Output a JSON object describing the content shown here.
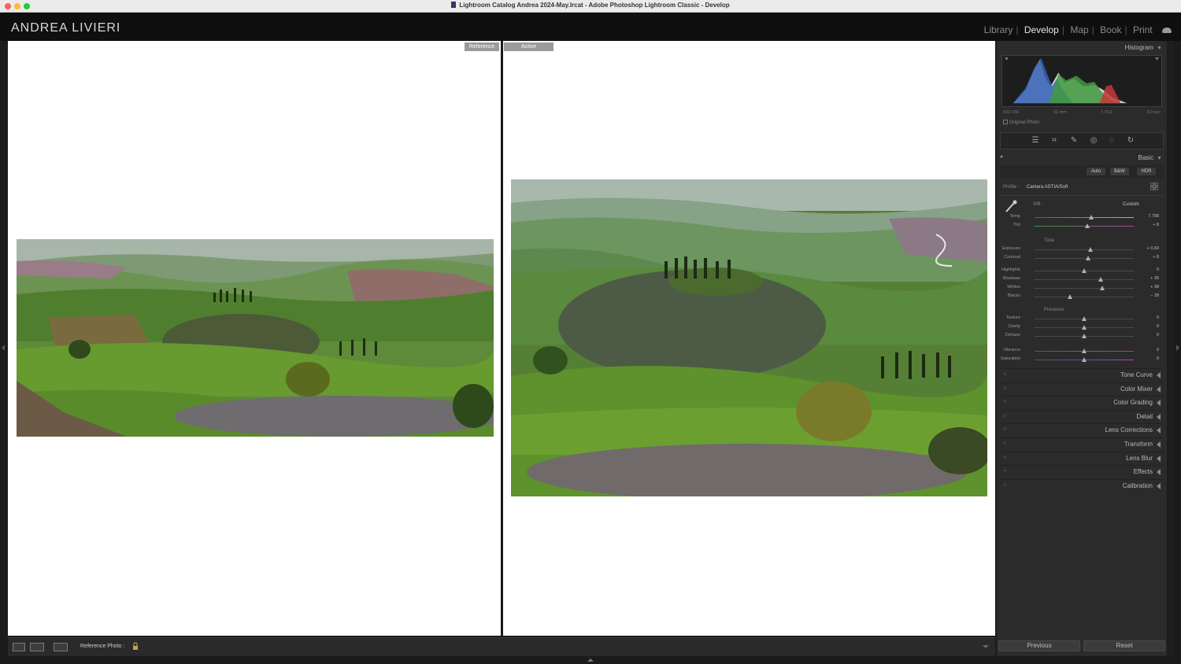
{
  "window": {
    "title": "Lightroom Catalog Andrea 2024-May.lrcat - Adobe Photoshop Lightroom Classic - Develop"
  },
  "header": {
    "identity": "ANDREA LIVIERI",
    "modules": [
      "Library",
      "Develop",
      "Map",
      "Book",
      "Print"
    ],
    "active_module": "Develop"
  },
  "view": {
    "reference_tag": "Reference",
    "active_tag": "Active"
  },
  "toolbar": {
    "reference_photo_label": "Reference Photo :"
  },
  "panel": {
    "histogram_title": "Histogram",
    "histogram_info": {
      "iso": "ISO 160",
      "focal": "61 mm",
      "aperture": "f / 8,0",
      "shutter": "3,0 sec"
    },
    "original_photo_label": "Original Photo",
    "basic_title": "Basic",
    "treatment_buttons": [
      "Auto",
      "B&W",
      "HDR"
    ],
    "profile_label": "Profile :",
    "profile_value": "Camera ASTIA/Soft",
    "wb_label": "WB :",
    "wb_value": "Custom",
    "tone_label": "Tone",
    "presence_label": "Presence",
    "sliders": {
      "temp": {
        "name": "Temp",
        "value": "7.798",
        "pos": 0.57
      },
      "tint": {
        "name": "Tint",
        "value": "+ 8",
        "pos": 0.53
      },
      "exposure": {
        "name": "Exposure",
        "value": "+ 0,60",
        "pos": 0.56
      },
      "contrast": {
        "name": "Contrast",
        "value": "+ 8",
        "pos": 0.54
      },
      "highlights": {
        "name": "Highlights",
        "value": "0",
        "pos": 0.5
      },
      "shadows": {
        "name": "Shadows",
        "value": "+ 35",
        "pos": 0.67
      },
      "whites": {
        "name": "Whites",
        "value": "+ 38",
        "pos": 0.68
      },
      "blacks": {
        "name": "Blacks",
        "value": "− 28",
        "pos": 0.36
      },
      "texture": {
        "name": "Texture",
        "value": "0",
        "pos": 0.5
      },
      "clarity": {
        "name": "Clarity",
        "value": "0",
        "pos": 0.5
      },
      "dehaze": {
        "name": "Dehaze",
        "value": "0",
        "pos": 0.5
      },
      "vibrance": {
        "name": "Vibrance",
        "value": "0",
        "pos": 0.5
      },
      "saturation": {
        "name": "Saturation",
        "value": "0",
        "pos": 0.5
      }
    },
    "collapsed_sections": [
      "Tone Curve",
      "Color Mixer",
      "Color Grading",
      "Detail",
      "Lens Corrections",
      "Transform",
      "Lens Blur",
      "Effects",
      "Calibration"
    ],
    "previous_button": "Previous",
    "reset_button": "Reset"
  }
}
